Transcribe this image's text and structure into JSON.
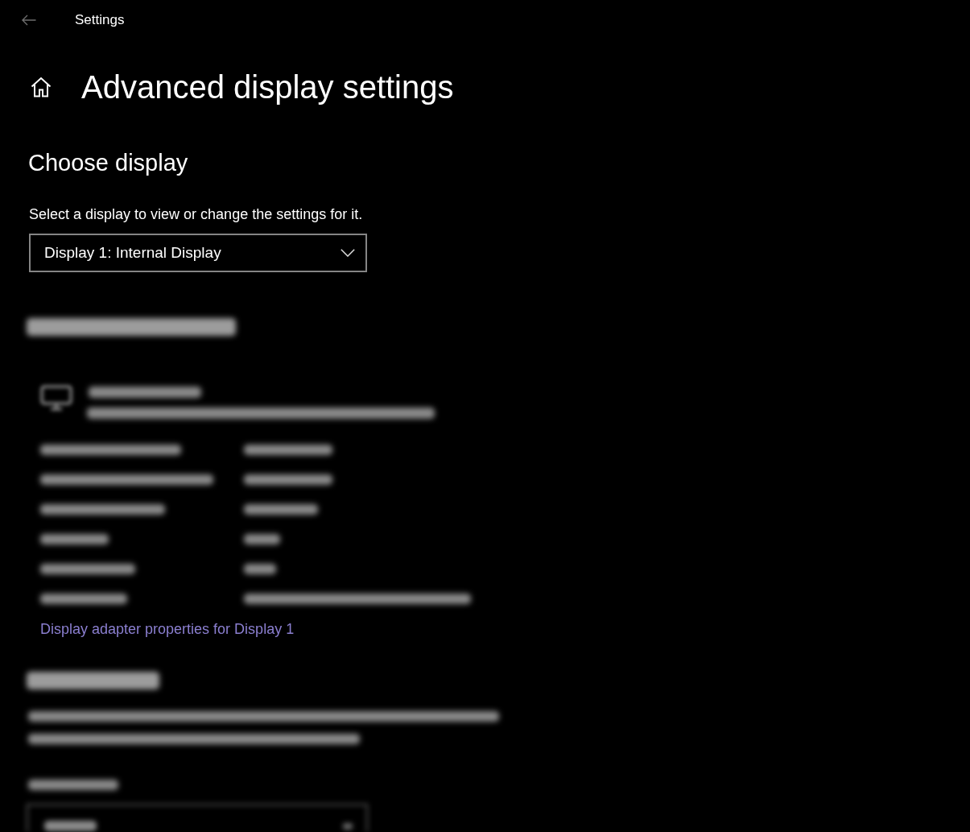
{
  "window": {
    "title": "Settings"
  },
  "header": {
    "title": "Advanced display settings"
  },
  "choose_display": {
    "heading": "Choose display",
    "label": "Select a display to view or change the settings for it.",
    "dropdown": {
      "value": "Display 1: Internal Display"
    }
  },
  "display_information": {
    "blurred_items": [
      {
        "kind": "heading"
      },
      {
        "kind": "device"
      },
      {
        "kind": "row"
      },
      {
        "kind": "row"
      },
      {
        "kind": "row"
      },
      {
        "kind": "row"
      },
      {
        "kind": "row"
      },
      {
        "kind": "row"
      }
    ],
    "link": "Display adapter properties for Display 1"
  },
  "refresh_rate": {
    "blurred_items": [
      {
        "kind": "heading"
      },
      {
        "kind": "paragraph"
      },
      {
        "kind": "label"
      },
      {
        "kind": "dropdown"
      }
    ]
  }
}
